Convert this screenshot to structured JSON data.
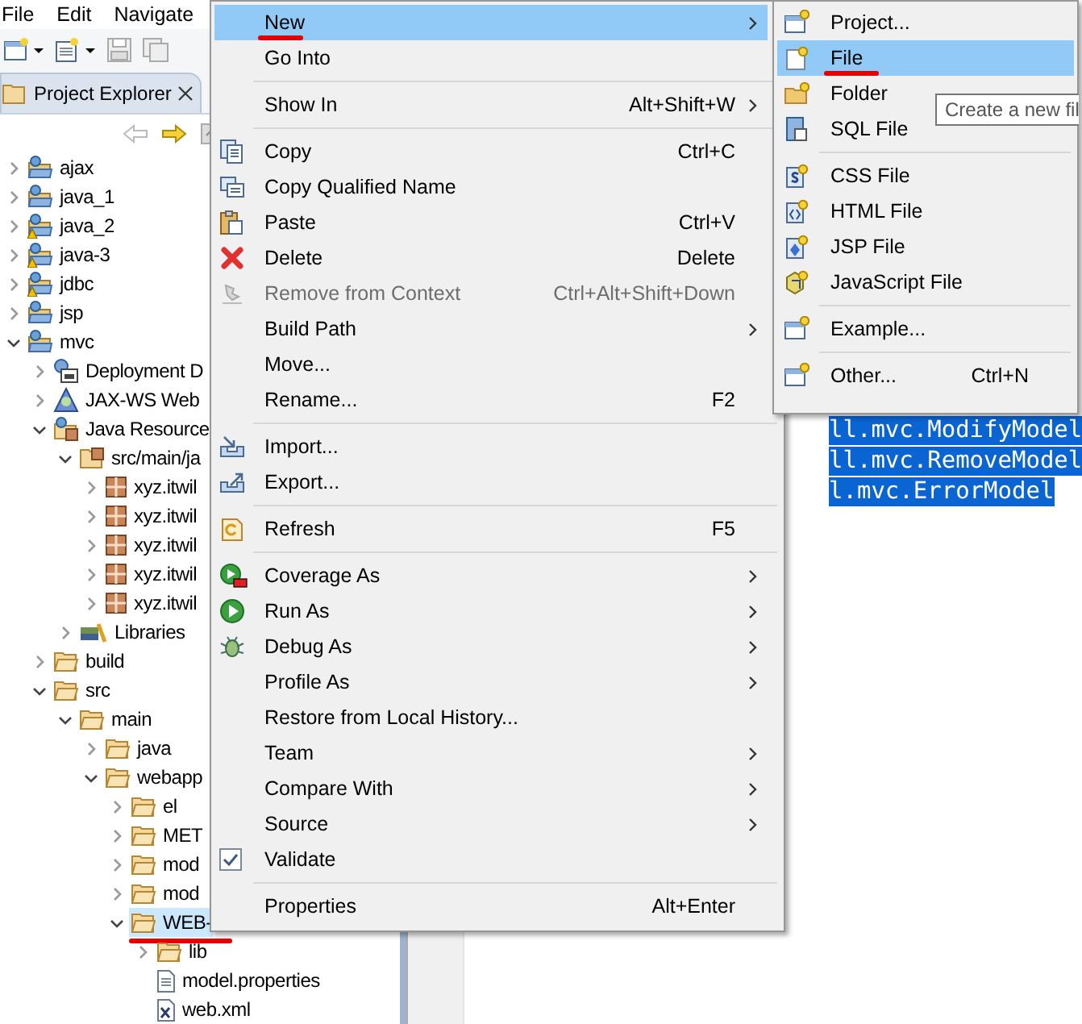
{
  "menu_bar": [
    "File",
    "Edit",
    "Navigate"
  ],
  "project_explorer": {
    "title": "Project Explorer",
    "tree": [
      {
        "label": "ajax",
        "kind": "project",
        "expanded": false,
        "selected": false,
        "underlined": false
      },
      {
        "label": "java_1",
        "kind": "project",
        "expanded": false,
        "selected": false,
        "underlined": false
      },
      {
        "label": "java_2",
        "kind": "project-warning",
        "expanded": false,
        "selected": false,
        "underlined": false
      },
      {
        "label": "java-3",
        "kind": "project-warning",
        "expanded": false,
        "selected": false,
        "underlined": false
      },
      {
        "label": "jdbc",
        "kind": "project-warning",
        "expanded": false,
        "selected": false,
        "underlined": false
      },
      {
        "label": "jsp",
        "kind": "project",
        "expanded": false,
        "selected": false,
        "underlined": false
      },
      {
        "label": "mvc",
        "kind": "project",
        "expanded": true,
        "selected": false,
        "underlined": false,
        "children": [
          {
            "label": "Deployment D",
            "kind": "deployment",
            "expanded": false,
            "selected": false,
            "underlined": false
          },
          {
            "label": "JAX-WS Web",
            "kind": "webservice",
            "expanded": false,
            "selected": false,
            "underlined": false
          },
          {
            "label": "Java Resource",
            "kind": "java-resources",
            "expanded": true,
            "selected": false,
            "underlined": false,
            "children": [
              {
                "label": "src/main/ja",
                "kind": "source-folder",
                "expanded": true,
                "selected": false,
                "underlined": false,
                "children": [
                  {
                    "label": "xyz.itwil",
                    "kind": "package",
                    "expanded": false,
                    "selected": false,
                    "underlined": false
                  },
                  {
                    "label": "xyz.itwil",
                    "kind": "package",
                    "expanded": false,
                    "selected": false,
                    "underlined": false
                  },
                  {
                    "label": "xyz.itwil",
                    "kind": "package",
                    "expanded": false,
                    "selected": false,
                    "underlined": false
                  },
                  {
                    "label": "xyz.itwil",
                    "kind": "package",
                    "expanded": false,
                    "selected": false,
                    "underlined": false
                  },
                  {
                    "label": "xyz.itwil",
                    "kind": "package",
                    "expanded": false,
                    "selected": false,
                    "underlined": false
                  }
                ]
              },
              {
                "label": "Libraries",
                "kind": "library",
                "expanded": false,
                "selected": false,
                "underlined": false
              }
            ]
          },
          {
            "label": "build",
            "kind": "folder",
            "expanded": false,
            "selected": false,
            "underlined": false
          },
          {
            "label": "src",
            "kind": "folder",
            "expanded": true,
            "selected": false,
            "underlined": false,
            "children": [
              {
                "label": "main",
                "kind": "folder",
                "expanded": true,
                "selected": false,
                "underlined": false,
                "children": [
                  {
                    "label": "java",
                    "kind": "folder",
                    "expanded": false,
                    "selected": false,
                    "underlined": false
                  },
                  {
                    "label": "webapp",
                    "kind": "folder",
                    "expanded": true,
                    "selected": false,
                    "underlined": false,
                    "children": [
                      {
                        "label": "el",
                        "kind": "folder",
                        "expanded": false,
                        "selected": false,
                        "underlined": false
                      },
                      {
                        "label": "MET",
                        "kind": "folder",
                        "expanded": false,
                        "selected": false,
                        "underlined": false
                      },
                      {
                        "label": "mod",
                        "kind": "folder",
                        "expanded": false,
                        "selected": false,
                        "underlined": false
                      },
                      {
                        "label": "mod",
                        "kind": "folder",
                        "expanded": false,
                        "selected": false,
                        "underlined": false
                      },
                      {
                        "label": "WEB-",
                        "kind": "folder",
                        "expanded": true,
                        "selected": true,
                        "underlined": true,
                        "children": [
                          {
                            "label": "lib",
                            "kind": "folder",
                            "expanded": false,
                            "selected": false,
                            "underlined": false
                          },
                          {
                            "label": "model.properties",
                            "kind": "file",
                            "selected": false,
                            "underlined": false
                          },
                          {
                            "label": "web.xml",
                            "kind": "xml-file",
                            "selected": false,
                            "underlined": false
                          }
                        ]
                      }
                    ]
                  }
                ]
              }
            ]
          }
        ]
      }
    ]
  },
  "editor": {
    "lines": [
      {
        "text": "ll.mvc.ModifyModel",
        "selected": true
      },
      {
        "text": "ll.mvc.RemoveModel",
        "selected": true
      },
      {
        "text": "l.mvc.ErrorModel",
        "selected": true
      }
    ]
  },
  "context_menu": {
    "items": [
      {
        "kind": "item",
        "label": "New",
        "submenu": true,
        "selected": true,
        "underlined": true,
        "disabled": false
      },
      {
        "kind": "item",
        "label": "Go Into",
        "submenu": false,
        "selected": false,
        "underlined": false,
        "disabled": false
      },
      {
        "kind": "separator"
      },
      {
        "kind": "item",
        "label": "Show In",
        "shortcut": "Alt+Shift+W",
        "submenu": true,
        "selected": false,
        "underlined": false,
        "disabled": false
      },
      {
        "kind": "separator"
      },
      {
        "kind": "item",
        "label": "Copy",
        "shortcut": "Ctrl+C",
        "submenu": false,
        "selected": false,
        "underlined": false,
        "disabled": false
      },
      {
        "kind": "item",
        "label": "Copy Qualified Name",
        "submenu": false,
        "selected": false,
        "underlined": false,
        "disabled": false
      },
      {
        "kind": "item",
        "label": "Paste",
        "shortcut": "Ctrl+V",
        "submenu": false,
        "selected": false,
        "underlined": false,
        "disabled": false
      },
      {
        "kind": "item",
        "label": "Delete",
        "shortcut": "Delete",
        "submenu": false,
        "selected": false,
        "underlined": false,
        "disabled": false
      },
      {
        "kind": "item",
        "label": "Remove from Context",
        "shortcut": "Ctrl+Alt+Shift+Down",
        "submenu": false,
        "selected": false,
        "underlined": false,
        "disabled": true
      },
      {
        "kind": "item",
        "label": "Build Path",
        "submenu": true,
        "selected": false,
        "underlined": false,
        "disabled": false
      },
      {
        "kind": "item",
        "label": "Move...",
        "submenu": false,
        "selected": false,
        "underlined": false,
        "disabled": false
      },
      {
        "kind": "item",
        "label": "Rename...",
        "shortcut": "F2",
        "submenu": false,
        "selected": false,
        "underlined": false,
        "disabled": false
      },
      {
        "kind": "separator"
      },
      {
        "kind": "item",
        "label": "Import...",
        "submenu": false,
        "selected": false,
        "underlined": false,
        "disabled": false
      },
      {
        "kind": "item",
        "label": "Export...",
        "submenu": false,
        "selected": false,
        "underlined": false,
        "disabled": false
      },
      {
        "kind": "separator"
      },
      {
        "kind": "item",
        "label": "Refresh",
        "shortcut": "F5",
        "submenu": false,
        "selected": false,
        "underlined": false,
        "disabled": false
      },
      {
        "kind": "separator"
      },
      {
        "kind": "item",
        "label": "Coverage As",
        "submenu": true,
        "selected": false,
        "underlined": false,
        "disabled": false
      },
      {
        "kind": "item",
        "label": "Run As",
        "submenu": true,
        "selected": false,
        "underlined": false,
        "disabled": false
      },
      {
        "kind": "item",
        "label": "Debug As",
        "submenu": true,
        "selected": false,
        "underlined": false,
        "disabled": false
      },
      {
        "kind": "item",
        "label": "Profile As",
        "submenu": true,
        "selected": false,
        "underlined": false,
        "disabled": false
      },
      {
        "kind": "item",
        "label": "Restore from Local History...",
        "submenu": false,
        "selected": false,
        "underlined": false,
        "disabled": false
      },
      {
        "kind": "item",
        "label": "Team",
        "submenu": true,
        "selected": false,
        "underlined": false,
        "disabled": false
      },
      {
        "kind": "item",
        "label": "Compare With",
        "submenu": true,
        "selected": false,
        "underlined": false,
        "disabled": false
      },
      {
        "kind": "item",
        "label": "Source",
        "submenu": true,
        "selected": false,
        "underlined": false,
        "disabled": false
      },
      {
        "kind": "item",
        "label": "Validate",
        "submenu": false,
        "selected": false,
        "underlined": false,
        "disabled": false
      },
      {
        "kind": "separator"
      },
      {
        "kind": "item",
        "label": "Properties",
        "shortcut": "Alt+Enter",
        "submenu": false,
        "selected": false,
        "underlined": false,
        "disabled": false
      }
    ]
  },
  "new_submenu": {
    "items": [
      {
        "kind": "item",
        "label": "Project...",
        "submenu": false,
        "selected": false,
        "underlined": false,
        "disabled": false
      },
      {
        "kind": "item",
        "label": "File",
        "submenu": false,
        "selected": true,
        "underlined": true,
        "disabled": false
      },
      {
        "kind": "item",
        "label": "Folder",
        "submenu": false,
        "selected": false,
        "underlined": false,
        "disabled": false
      },
      {
        "kind": "item",
        "label": "SQL File",
        "submenu": false,
        "selected": false,
        "underlined": false,
        "disabled": false
      },
      {
        "kind": "separator"
      },
      {
        "kind": "item",
        "label": "CSS File",
        "submenu": false,
        "selected": false,
        "underlined": false,
        "disabled": false
      },
      {
        "kind": "item",
        "label": "HTML File",
        "submenu": false,
        "selected": false,
        "underlined": false,
        "disabled": false
      },
      {
        "kind": "item",
        "label": "JSP File",
        "submenu": false,
        "selected": false,
        "underlined": false,
        "disabled": false
      },
      {
        "kind": "item",
        "label": "JavaScript File",
        "submenu": false,
        "selected": false,
        "underlined": false,
        "disabled": false
      },
      {
        "kind": "separator"
      },
      {
        "kind": "item",
        "label": "Example...",
        "submenu": false,
        "selected": false,
        "underlined": false,
        "disabled": false
      },
      {
        "kind": "separator"
      },
      {
        "kind": "item",
        "label": "Other...",
        "shortcut": "Ctrl+N",
        "submenu": false,
        "selected": false,
        "underlined": false,
        "disabled": false
      }
    ]
  },
  "tooltip": "Create a new fil"
}
